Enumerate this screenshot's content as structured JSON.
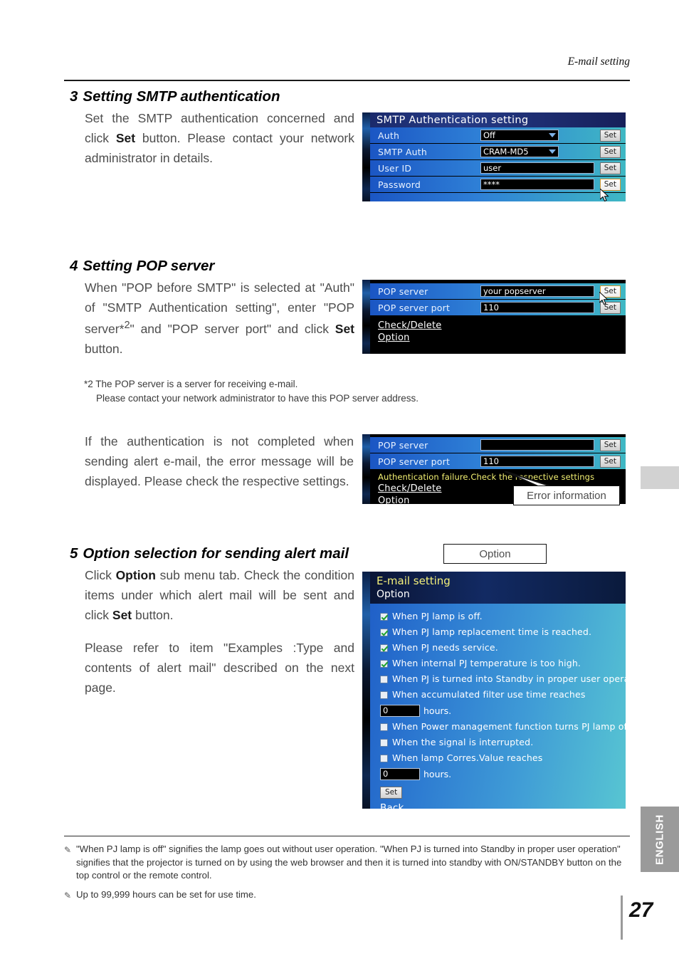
{
  "header": {
    "running_head": "E-mail setting",
    "page_number": "27",
    "side_tab": "ENGLISH"
  },
  "steps": [
    {
      "number": "3",
      "title": "Setting SMTP authentication",
      "paragraphs": [
        "Set the SMTP authentication concerned and click <b>Set</b> button. Please contact your network administrator in details."
      ]
    },
    {
      "number": "4",
      "title": "Setting POP server",
      "paragraphs": [
        "When \"POP before SMTP\" is selected at \"Auth\" of \"SMTP Authentication setting\", enter \"POP server*<sup>2</sup>\" and \"POP server port\" and click <b>Set</b> button."
      ]
    },
    {
      "number": "5",
      "title": "Option selection for sending alert mail",
      "paragraphs": [
        "Click <b>Option</b> sub menu tab. Check the condition items under which alert mail will be sent and click <b>Set</b> button.",
        "Please refer to item \"Examples :Type and contents of alert mail\" described on the next page."
      ]
    }
  ],
  "footnote2": {
    "line1": "*2 The POP server is a server for receiving e-mail.",
    "line2": "Please contact your network administrator to have this POP server address."
  },
  "error_paragraph": "If the authentication is not completed when sending alert e-mail, the error message will be displayed. Please check the respective settings.",
  "callouts": {
    "error_information": "Error information",
    "option": "Option"
  },
  "notes": [
    {
      "glyph": "✎",
      "text": "\"When PJ lamp is off\" signifies the lamp goes out without user operation. \"When PJ is turned into Standby  in proper user operation\" signifies that the projector is turned on by using the web browser and then it is turned into standby with ON/STANDBY button on the top control or the remote control."
    },
    {
      "glyph": "✎",
      "text": "Up to 99,999 hours can be set for use time."
    }
  ],
  "screens": {
    "smtp_auth": {
      "title": "SMTP Authentication setting",
      "rows": [
        {
          "label": "Auth",
          "value": "Off",
          "kind": "select",
          "button": "Set"
        },
        {
          "label": "SMTP Auth",
          "value": "CRAM-MD5",
          "kind": "select",
          "button": "Set"
        },
        {
          "label": "User ID",
          "value": "user",
          "kind": "text",
          "button": "Set"
        },
        {
          "label": "Password",
          "value": "****",
          "kind": "text",
          "button": "Set"
        }
      ]
    },
    "pop_server": {
      "rows": [
        {
          "label": "POP server",
          "value": "your popserver",
          "button": "Set"
        },
        {
          "label": "POP server port",
          "value": "110",
          "button": "Set"
        }
      ],
      "links": [
        "Check/Delete",
        "Option"
      ]
    },
    "pop_server_error": {
      "rows": [
        {
          "label": "POP server",
          "value": "",
          "button": "Set"
        },
        {
          "label": "POP server port",
          "value": "110",
          "button": "Set"
        }
      ],
      "error_message": "Authentication failure.Check the respective settings",
      "links": [
        "Check/Delete",
        "Option"
      ]
    },
    "email_option": {
      "title": "E-mail setting",
      "subtitle": "Option",
      "checkboxes": [
        {
          "label": "When PJ lamp is off.",
          "checked": true
        },
        {
          "label": "When PJ lamp replacement time is reached.",
          "checked": true
        },
        {
          "label": "When PJ needs service.",
          "checked": true
        },
        {
          "label": "When internal PJ temperature is too high.",
          "checked": true
        },
        {
          "label": "When PJ is turned into Standby in proper user operation.",
          "checked": false
        },
        {
          "label": "When accumulated filter use time reaches",
          "checked": false
        }
      ],
      "hours_field_1": {
        "value": "0",
        "suffix": "hours."
      },
      "checkboxes_2": [
        {
          "label": "When Power management function turns PJ lamp off.",
          "checked": false
        },
        {
          "label": "When the signal is interrupted.",
          "checked": false
        },
        {
          "label": "When lamp Corres.Value reaches",
          "checked": false
        }
      ],
      "hours_field_2": {
        "value": "0",
        "suffix": "hours."
      },
      "set_button": "Set",
      "back_link": "Back"
    }
  },
  "colors": {
    "panel_blue": "#2060c8",
    "panel_cyan": "#58c6d2",
    "title_navy": "#1b2a6b",
    "error_yellow": "#f2ef72",
    "tab_gray": "#9a9a9a"
  }
}
